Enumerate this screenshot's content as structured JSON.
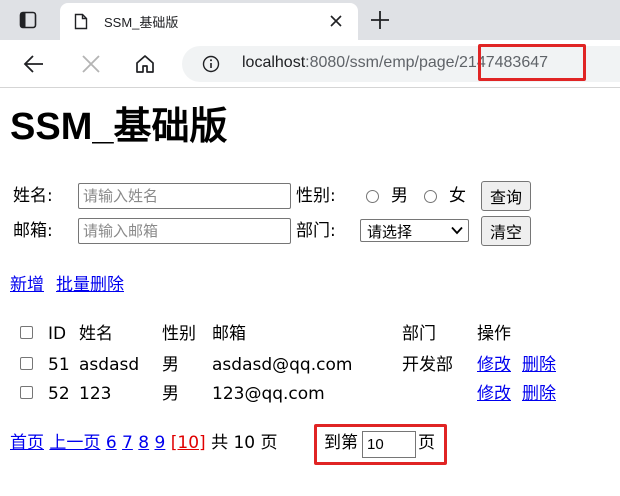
{
  "browser": {
    "tab_title": "SSM_基础版",
    "url_host": "localhost",
    "url_path": ":8080/ssm/emp/page/",
    "url_page": "2147483647"
  },
  "page": {
    "title": "SSM_基础版"
  },
  "search_form": {
    "name_label": "姓名:",
    "name_placeholder": "请输入姓名",
    "email_label": "邮箱:",
    "email_placeholder": "请输入邮箱",
    "gender_label": "性别:",
    "gender_options": [
      "男",
      "女"
    ],
    "dept_label": "部门:",
    "dept_selected": "请选择",
    "query_button": "查询",
    "clear_button": "清空"
  },
  "actions": {
    "add": "新增",
    "batch_delete": "批量删除"
  },
  "table": {
    "headers": [
      "ID",
      "姓名",
      "性别",
      "邮箱",
      "部门",
      "操作"
    ],
    "rows": [
      {
        "id": "51",
        "name": "asdasd",
        "gender": "男",
        "email": "asdasd@qq.com",
        "dept": "开发部",
        "edit": "修改",
        "delete": "删除"
      },
      {
        "id": "52",
        "name": "123",
        "gender": "男",
        "email": "123@qq.com",
        "dept": "",
        "edit": "修改",
        "delete": "删除"
      }
    ]
  },
  "pagination": {
    "first": "首页",
    "prev": "上一页",
    "pages": [
      "6",
      "7",
      "8",
      "9"
    ],
    "current": "[10]",
    "total_text": "共 10 页",
    "goto_label": "到第",
    "goto_value": "10",
    "goto_suffix": "页"
  },
  "colors": {
    "link": "#0000ee",
    "current_page": "#e00000",
    "highlight_box": "#e02424"
  }
}
